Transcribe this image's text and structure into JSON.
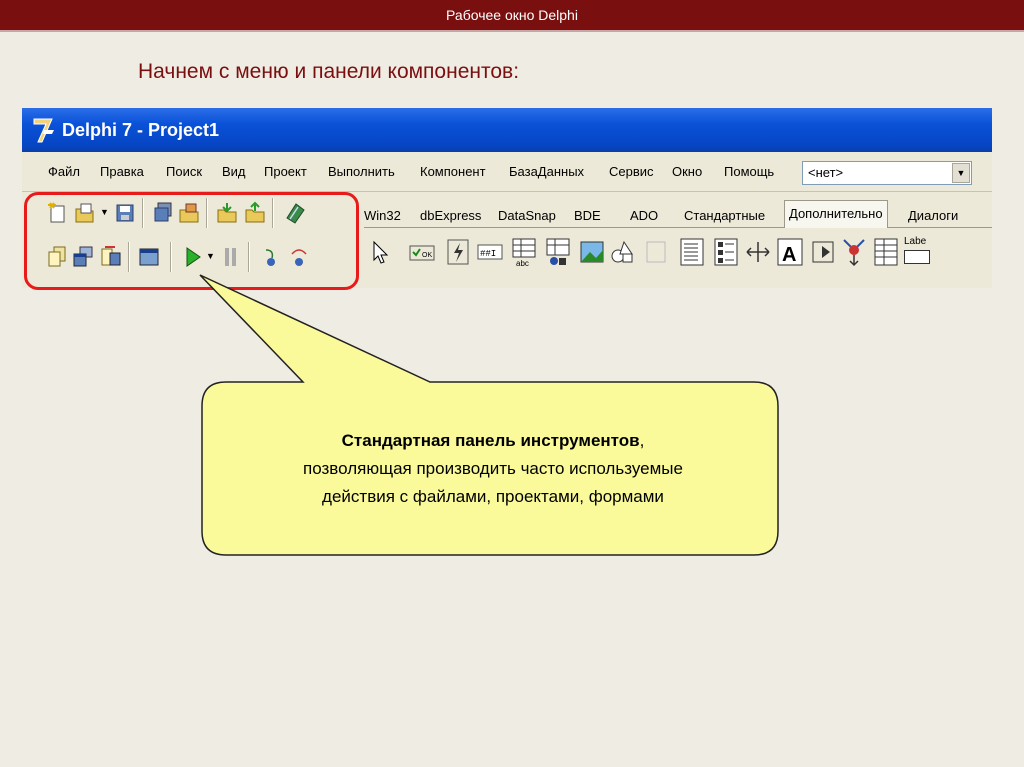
{
  "slide": {
    "title": "Рабочее окно Delphi",
    "heading": "Начнем с меню и панели компонентов:"
  },
  "ide": {
    "window_title": "Delphi 7 - Project1",
    "menu": [
      "Файл",
      "Правка",
      "Поиск",
      "Вид",
      "Проект",
      "Выполнить",
      "Компонент",
      "БазаДанных",
      "Сервис",
      "Окно",
      "Помощь"
    ],
    "combo_value": "<нет>",
    "tabs": [
      "Win32",
      "dbExpress",
      "DataSnap",
      "BDE",
      "ADO",
      "Стандартные",
      "Дополнительно",
      "Диалоги"
    ],
    "active_tab": "Дополнительно",
    "toolbar_row1": [
      "new-icon",
      "open-icon",
      "save-icon",
      "save-all-icon",
      "open-project-icon",
      "add-file-icon",
      "remove-file-icon",
      "help-icon"
    ],
    "toolbar_row2": [
      "view-unit-icon",
      "view-form-icon",
      "toggle-form-unit-icon",
      "new-form-icon",
      "run-icon",
      "pause-icon",
      "trace-into-icon",
      "step-over-icon"
    ],
    "palette_items": [
      "pointer-icon",
      "bitbtn-icon",
      "speedbutton-icon",
      "maskedit-icon",
      "stringgrid-icon",
      "drawgrid-icon",
      "image-icon",
      "shape-icon",
      "bevel-icon",
      "scrollbox-icon",
      "checklistbox-icon",
      "splitter-icon",
      "statictext-icon",
      "controlbar-icon",
      "applicationevents-icon",
      "valuelisteditor-icon",
      "labelededit-icon"
    ],
    "labelededit_caption": "Labe"
  },
  "callout": {
    "bold_text": "Стандартная панель инструментов",
    "text_after_bold": ",",
    "line2": "позволяющая производить часто используемые",
    "line3": "действия с файлами, проектами, формами"
  },
  "colors": {
    "slide_bar": "#7a0f0f",
    "heading": "#7a0f0f",
    "highlight": "#e81b1b",
    "callout_fill": "#fafa9a",
    "titlebar": "#0a52d8"
  }
}
